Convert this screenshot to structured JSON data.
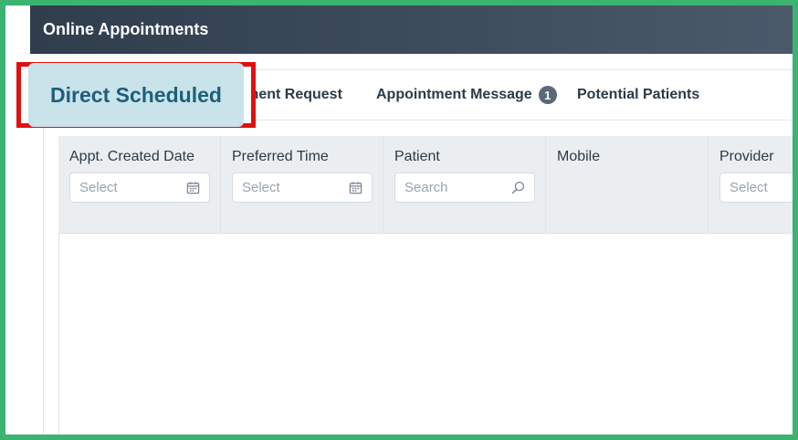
{
  "header": {
    "title": "Online Appointments"
  },
  "tabs": [
    {
      "label": "Direct Scheduled"
    },
    {
      "label": "ntment Request"
    },
    {
      "label": "Appointment Message",
      "badge": "1"
    },
    {
      "label": "Potential Patients"
    }
  ],
  "columns": [
    {
      "label": "Appt. Created Date",
      "placeholder": "Select",
      "icon": "calendar-icon"
    },
    {
      "label": "Preferred Time",
      "placeholder": "Select",
      "icon": "calendar-icon"
    },
    {
      "label": "Patient",
      "placeholder": "Search",
      "icon": "search-icon"
    },
    {
      "label": "Mobile"
    },
    {
      "label": "Provider",
      "placeholder": "Select"
    }
  ]
}
